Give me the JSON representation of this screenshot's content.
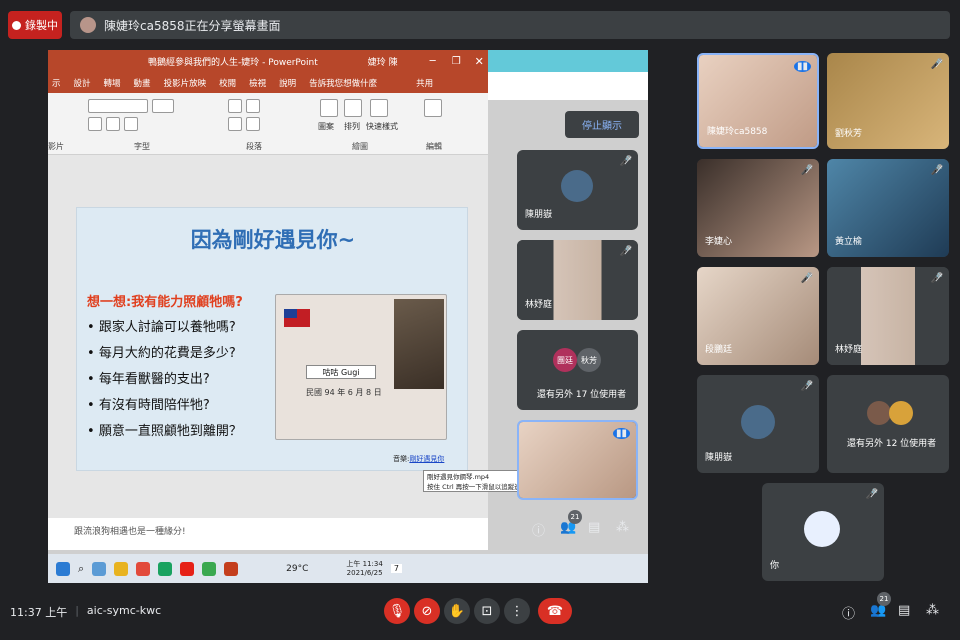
{
  "topbar": {
    "record_label": "錄製中",
    "presenting_text": "陳婕玲ca5858正在分享螢幕畫面"
  },
  "powerpoint": {
    "title": "鴨鵝經參與我們的人生-婕玲  -  PowerPoint",
    "user": "婕玲 陳",
    "tabs": [
      "示",
      "設計",
      "轉場",
      "動畫",
      "投影片放映",
      "校閱",
      "檢視",
      "說明",
      "告訴我您想做什麼",
      "共用"
    ],
    "groups": [
      "影片",
      "字型",
      "段落",
      "繪圖",
      "編輯"
    ],
    "ribbon_buttons": [
      "圖案",
      "排列",
      "快速樣式"
    ]
  },
  "slide": {
    "title": "因為剛好遇見你~",
    "question": "想一想:我有能力照顧牠嗎?",
    "bullets": [
      "跟家人討論可以養牠嗎?",
      "每月大約的花費是多少?",
      "每年看獸醫的支出?",
      "有沒有時間陪伴牠?",
      "願意一直照顧牠到離開？"
    ],
    "card_name": "咕咕  Gugi",
    "card_date": "民國 94 年 6 月 8 日",
    "music_prefix": "音樂:",
    "music_link": "剛好遇見你"
  },
  "notes": "跟流浪狗相遇也是一種緣分!",
  "tooltip": {
    "line1": "剛好遇見你鋼琴.mp4",
    "line2": "按住 Ctrl 再按一下滑鼠以追蹤連結"
  },
  "taskbar": {
    "weather": "29°C",
    "time": "上午 11:34",
    "date": "2021/6/25",
    "notif": "7"
  },
  "stop_label": "停止顯示",
  "mid_tiles": [
    {
      "name": "陳朋嶽"
    },
    {
      "name": "林妤庭"
    },
    {
      "name": "還有另外 17 位使用者",
      "chip1": "團廷",
      "chip2": "秋芳"
    },
    {
      "name": ""
    }
  ],
  "right_tiles": [
    {
      "name": "陳婕玲ca5858"
    },
    {
      "name": "劉秋芳"
    },
    {
      "name": "李婕心"
    },
    {
      "name": "黃立榆"
    },
    {
      "name": "段鵬廷"
    },
    {
      "name": "林妤庭"
    },
    {
      "name": "陳朋嶽"
    },
    {
      "name": "還有另外 12 位使用者"
    },
    {
      "name": "你"
    }
  ],
  "people_count": "21",
  "bottom": {
    "time": "11:37 上午",
    "meeting_code": "aic-symc-kwc"
  },
  "colors": {
    "ppt_red": "#b7472a",
    "meet_bg": "#202124",
    "tile_bg": "#3c4043",
    "hangup": "#d93025"
  }
}
